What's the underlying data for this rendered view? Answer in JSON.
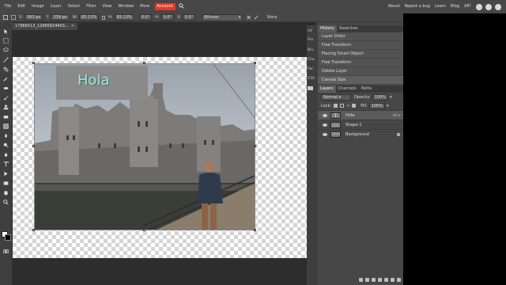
{
  "menu": {
    "items": [
      "File",
      "Edit",
      "Image",
      "Layer",
      "Select",
      "Filter",
      "View",
      "Window",
      "More"
    ],
    "account": "Account",
    "right_items": [
      "About",
      "Report a bug",
      "Learn",
      "Blog",
      "API"
    ],
    "accent": "#e03a2a"
  },
  "options": {
    "x_label": "X:",
    "x_value": "563 px",
    "y_label": "Y:",
    "y_value": "339 px",
    "w_label": "W:",
    "w_value": "83.13%",
    "h_label": "H:",
    "h_value": "83.13%",
    "h_angle": "0.0°",
    "v_angle": "0.0°",
    "rot_angle": "0.0°",
    "interpolation": "Bilinear",
    "warp_label": "Warp"
  },
  "document": {
    "tab_title": "17966513_12965824403...",
    "text_layer_text": "Hola",
    "shape_color": "#8a8a8a",
    "text_color": "#a7e1d8"
  },
  "mini_panels": [
    "Inf",
    "Pro",
    "Bru",
    "Cha",
    "Par",
    "CSS"
  ],
  "history": {
    "tabs": [
      "History",
      "Swatches"
    ],
    "items": [
      "Layer Order",
      "Free Transform",
      "Placing Smart Object",
      "Free Transform",
      "Delete Layer",
      "Canvas Size"
    ]
  },
  "layers": {
    "tabs": [
      "Layers",
      "Channels",
      "Paths"
    ],
    "blend_mode": "Normal",
    "opacity_label": "Opacity:",
    "opacity_value": "100%",
    "lock_label": "Lock:",
    "fill_label": "Fill:",
    "fill_value": "100%",
    "list": [
      {
        "name": "Hola"
      },
      {
        "name": "Shape 1"
      },
      {
        "name": "Background"
      }
    ]
  }
}
